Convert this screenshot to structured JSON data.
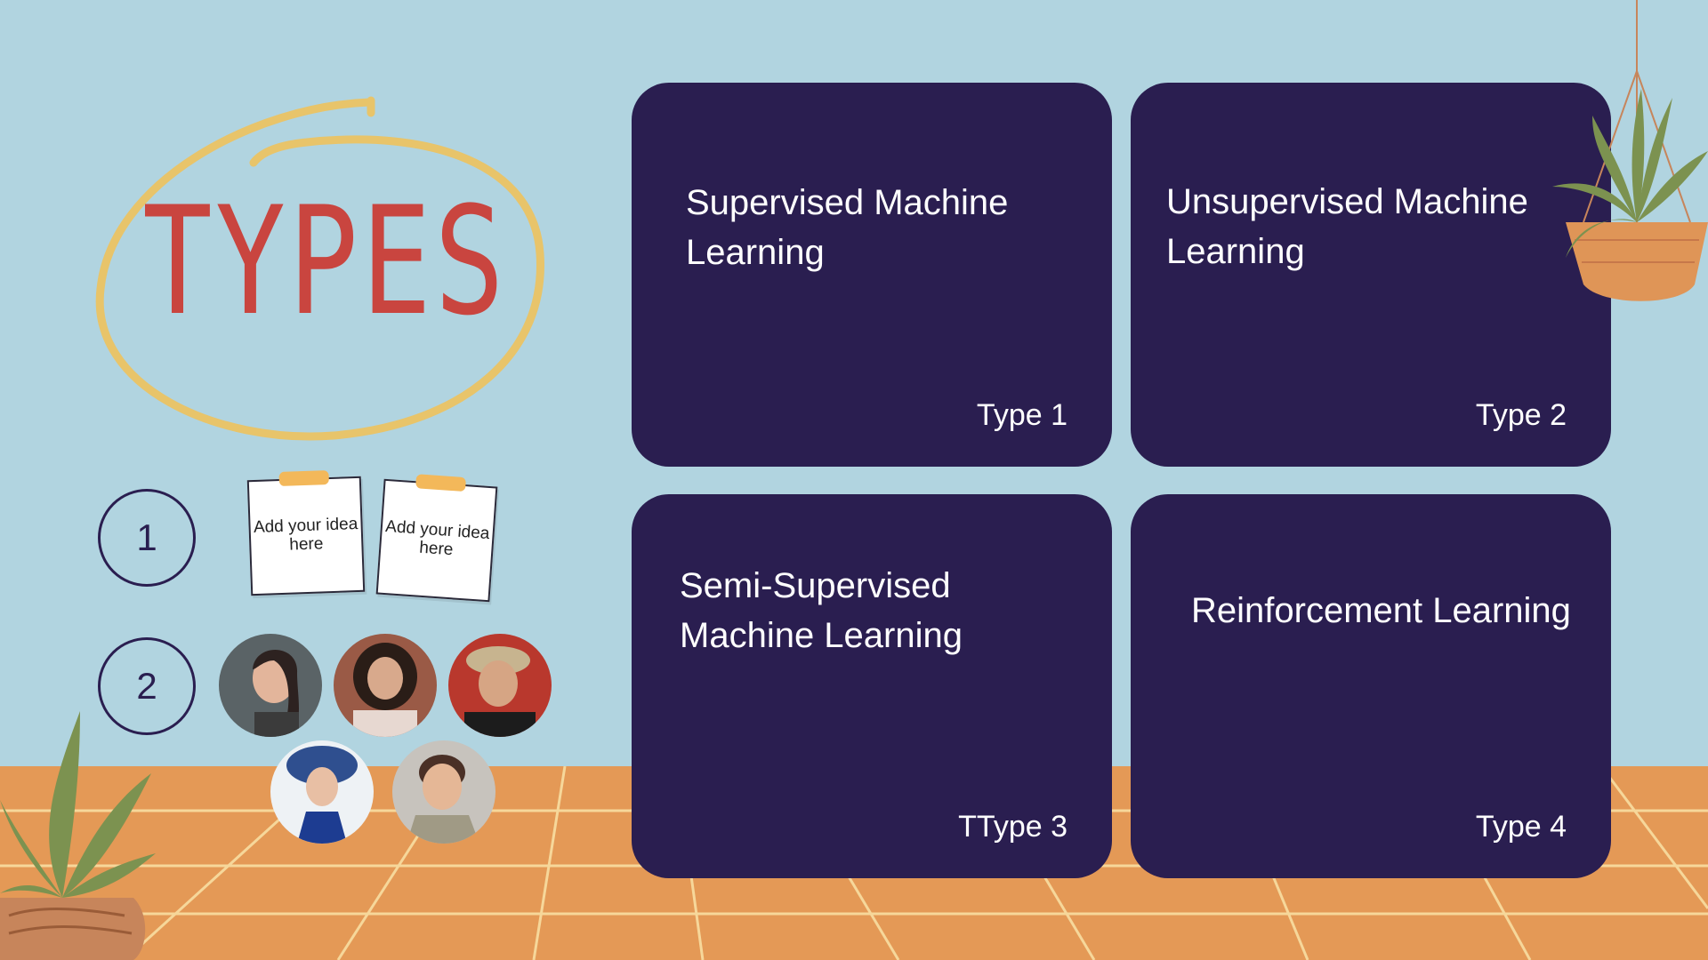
{
  "slide": {
    "title": "TYPES",
    "steps": [
      {
        "label": "1"
      },
      {
        "label": "2"
      }
    ],
    "notes": [
      {
        "text": "Add your idea here"
      },
      {
        "text": "Add your idea here"
      }
    ],
    "cards": [
      {
        "title": "Supervised Machine Learning",
        "type": "Type 1"
      },
      {
        "title": "Unsupervised Machine Learning",
        "type": "Type 2"
      },
      {
        "title": "Semi-Supervised Machine Learning",
        "type": "TType 3"
      },
      {
        "title": "Reinforcement Learning",
        "type": "Type 4"
      }
    ]
  },
  "colors": {
    "background": "#b1d4e0",
    "card": "#2a1e50",
    "title": "#c9453f",
    "ring": "#e8c46a",
    "floor": "#e49956",
    "tape": "#f3b85a"
  }
}
